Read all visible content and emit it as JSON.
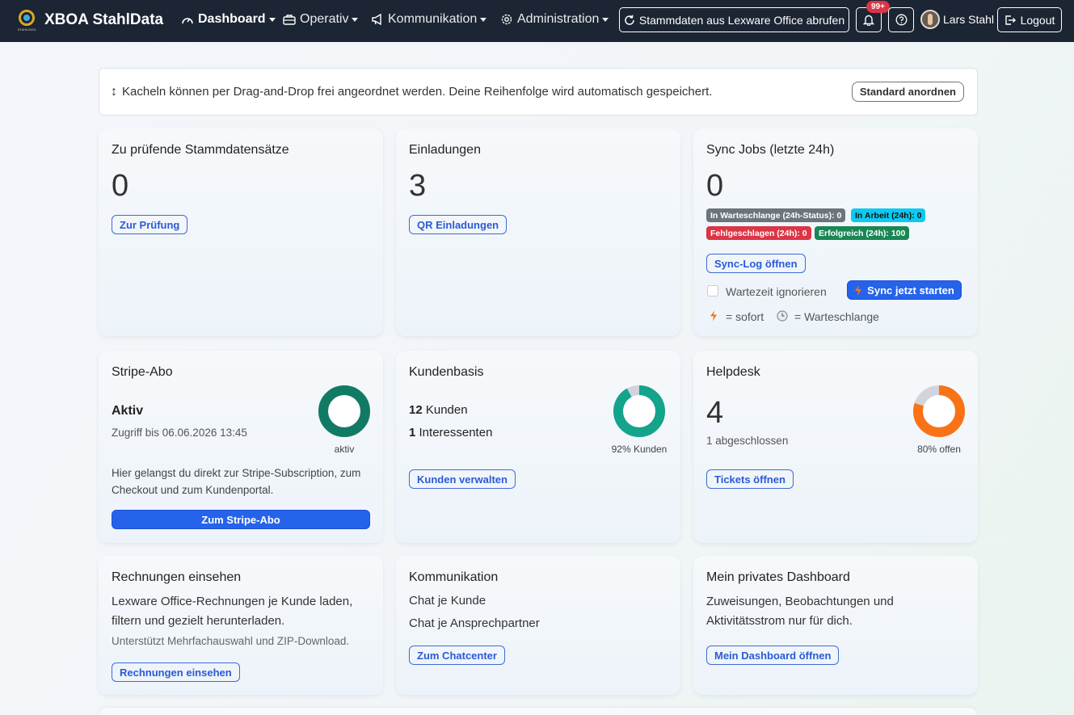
{
  "navbar": {
    "brand": "XBOA StahlData",
    "logo_text": "STAHLDATA",
    "items": [
      {
        "label": "Dashboard",
        "icon": "gauge-icon"
      },
      {
        "label": "Operativ",
        "icon": "briefcase-icon"
      },
      {
        "label": "Kommunikation",
        "icon": "megaphone-icon"
      },
      {
        "label": "Administration",
        "icon": "gear-icon"
      }
    ],
    "sync_button": "Stammdaten aus Lexware Office abrufen",
    "notification_badge": "99+",
    "user_name": "Lars Stahl",
    "logout": "Logout"
  },
  "infobar": {
    "text": "Kacheln können per Drag-and-Drop frei angeordnet werden. Deine Reihenfolge wird automatisch gespeichert.",
    "button": "Standard anordnen"
  },
  "cards": {
    "review": {
      "title": "Zu prüfende Stammdatensätze",
      "value": "0",
      "button": "Zur Prüfung"
    },
    "invites": {
      "title": "Einladungen",
      "value": "3",
      "button": "QR Einladungen"
    },
    "sync": {
      "title": "Sync Jobs (letzte 24h)",
      "value": "0",
      "tags": {
        "queued": "In Warteschlange (24h-Status): 0",
        "working": "In Arbeit (24h): 0",
        "failed": "Fehlgeschlagen (24h): 0",
        "success": "Erfolgreich (24h): 100"
      },
      "log_button": "Sync-Log öffnen",
      "ignore_wait": "Wartezeit ignorieren",
      "start_button": "Sync jetzt starten",
      "legend_now": "= sofort",
      "legend_queue": "= Warteschlange"
    },
    "stripe": {
      "title": "Stripe-Abo",
      "status": "Aktiv",
      "access": "Zugriff bis 06.06.2026 13:45",
      "donut_label": "aktiv",
      "donut_fraction": 1.0,
      "description": "Hier gelangst du direkt zur Stripe-Subscription, zum Checkout und zum Kundenportal.",
      "button": "Zum Stripe-Abo"
    },
    "customers": {
      "title": "Kundenbasis",
      "customers_count": "12",
      "customers_label": "Kunden",
      "leads_count": "1",
      "leads_label": "Interessenten",
      "donut_label": "92% Kunden",
      "donut_fraction": 0.92,
      "button": "Kunden verwalten"
    },
    "helpdesk": {
      "title": "Helpdesk",
      "value": "4",
      "closed": "1 abgeschlossen",
      "donut_label": "80% offen",
      "donut_fraction": 0.8,
      "button": "Tickets öffnen"
    },
    "invoices": {
      "title": "Rechnungen einsehen",
      "text": "Lexware Office-Rechnungen je Kunde laden, filtern und gezielt herunterladen.",
      "sub": "Unterstützt Mehrfachauswahl und ZIP-Download.",
      "button": "Rechnungen einsehen"
    },
    "communication": {
      "title": "Kommunikation",
      "line1": "Chat je Kunde",
      "line2": "Chat je Ansprechpartner",
      "button": "Zum Chatcenter"
    },
    "private": {
      "title": "Mein privates Dashboard",
      "text": "Zuweisungen, Beobachtungen und Aktivitätsstrom nur für dich.",
      "button": "Mein Dashboard öffnen"
    }
  },
  "colors": {
    "navbar_bg": "#1c2533",
    "primary": "#2563eb",
    "teal_dark": "#117a65",
    "teal": "#14a38b",
    "orange": "#f97316",
    "ring_grey": "#d1d5db",
    "tag_grey": "#6c757d",
    "tag_cyan": "#0dcaf0",
    "tag_red": "#dc3545",
    "tag_green": "#198754"
  }
}
